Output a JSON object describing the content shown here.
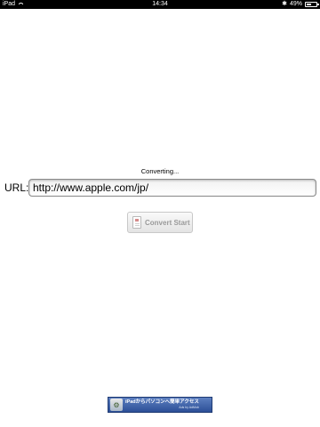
{
  "status_bar": {
    "device": "iPad",
    "time": "14:34",
    "battery_text": "49%",
    "battery_level": 0.49
  },
  "status_text": "Converting...",
  "url": {
    "label": "URL:",
    "value": "http://www.apple.com/jp/"
  },
  "convert_button": {
    "label": "Convert Start"
  },
  "ad": {
    "title": "iPadからパソコンへ簡単アクセス",
    "subtitle": "Ads by AdMob"
  },
  "colors": {
    "status_bar_bg": "#000000",
    "ad_bg": "#2c4f97"
  }
}
